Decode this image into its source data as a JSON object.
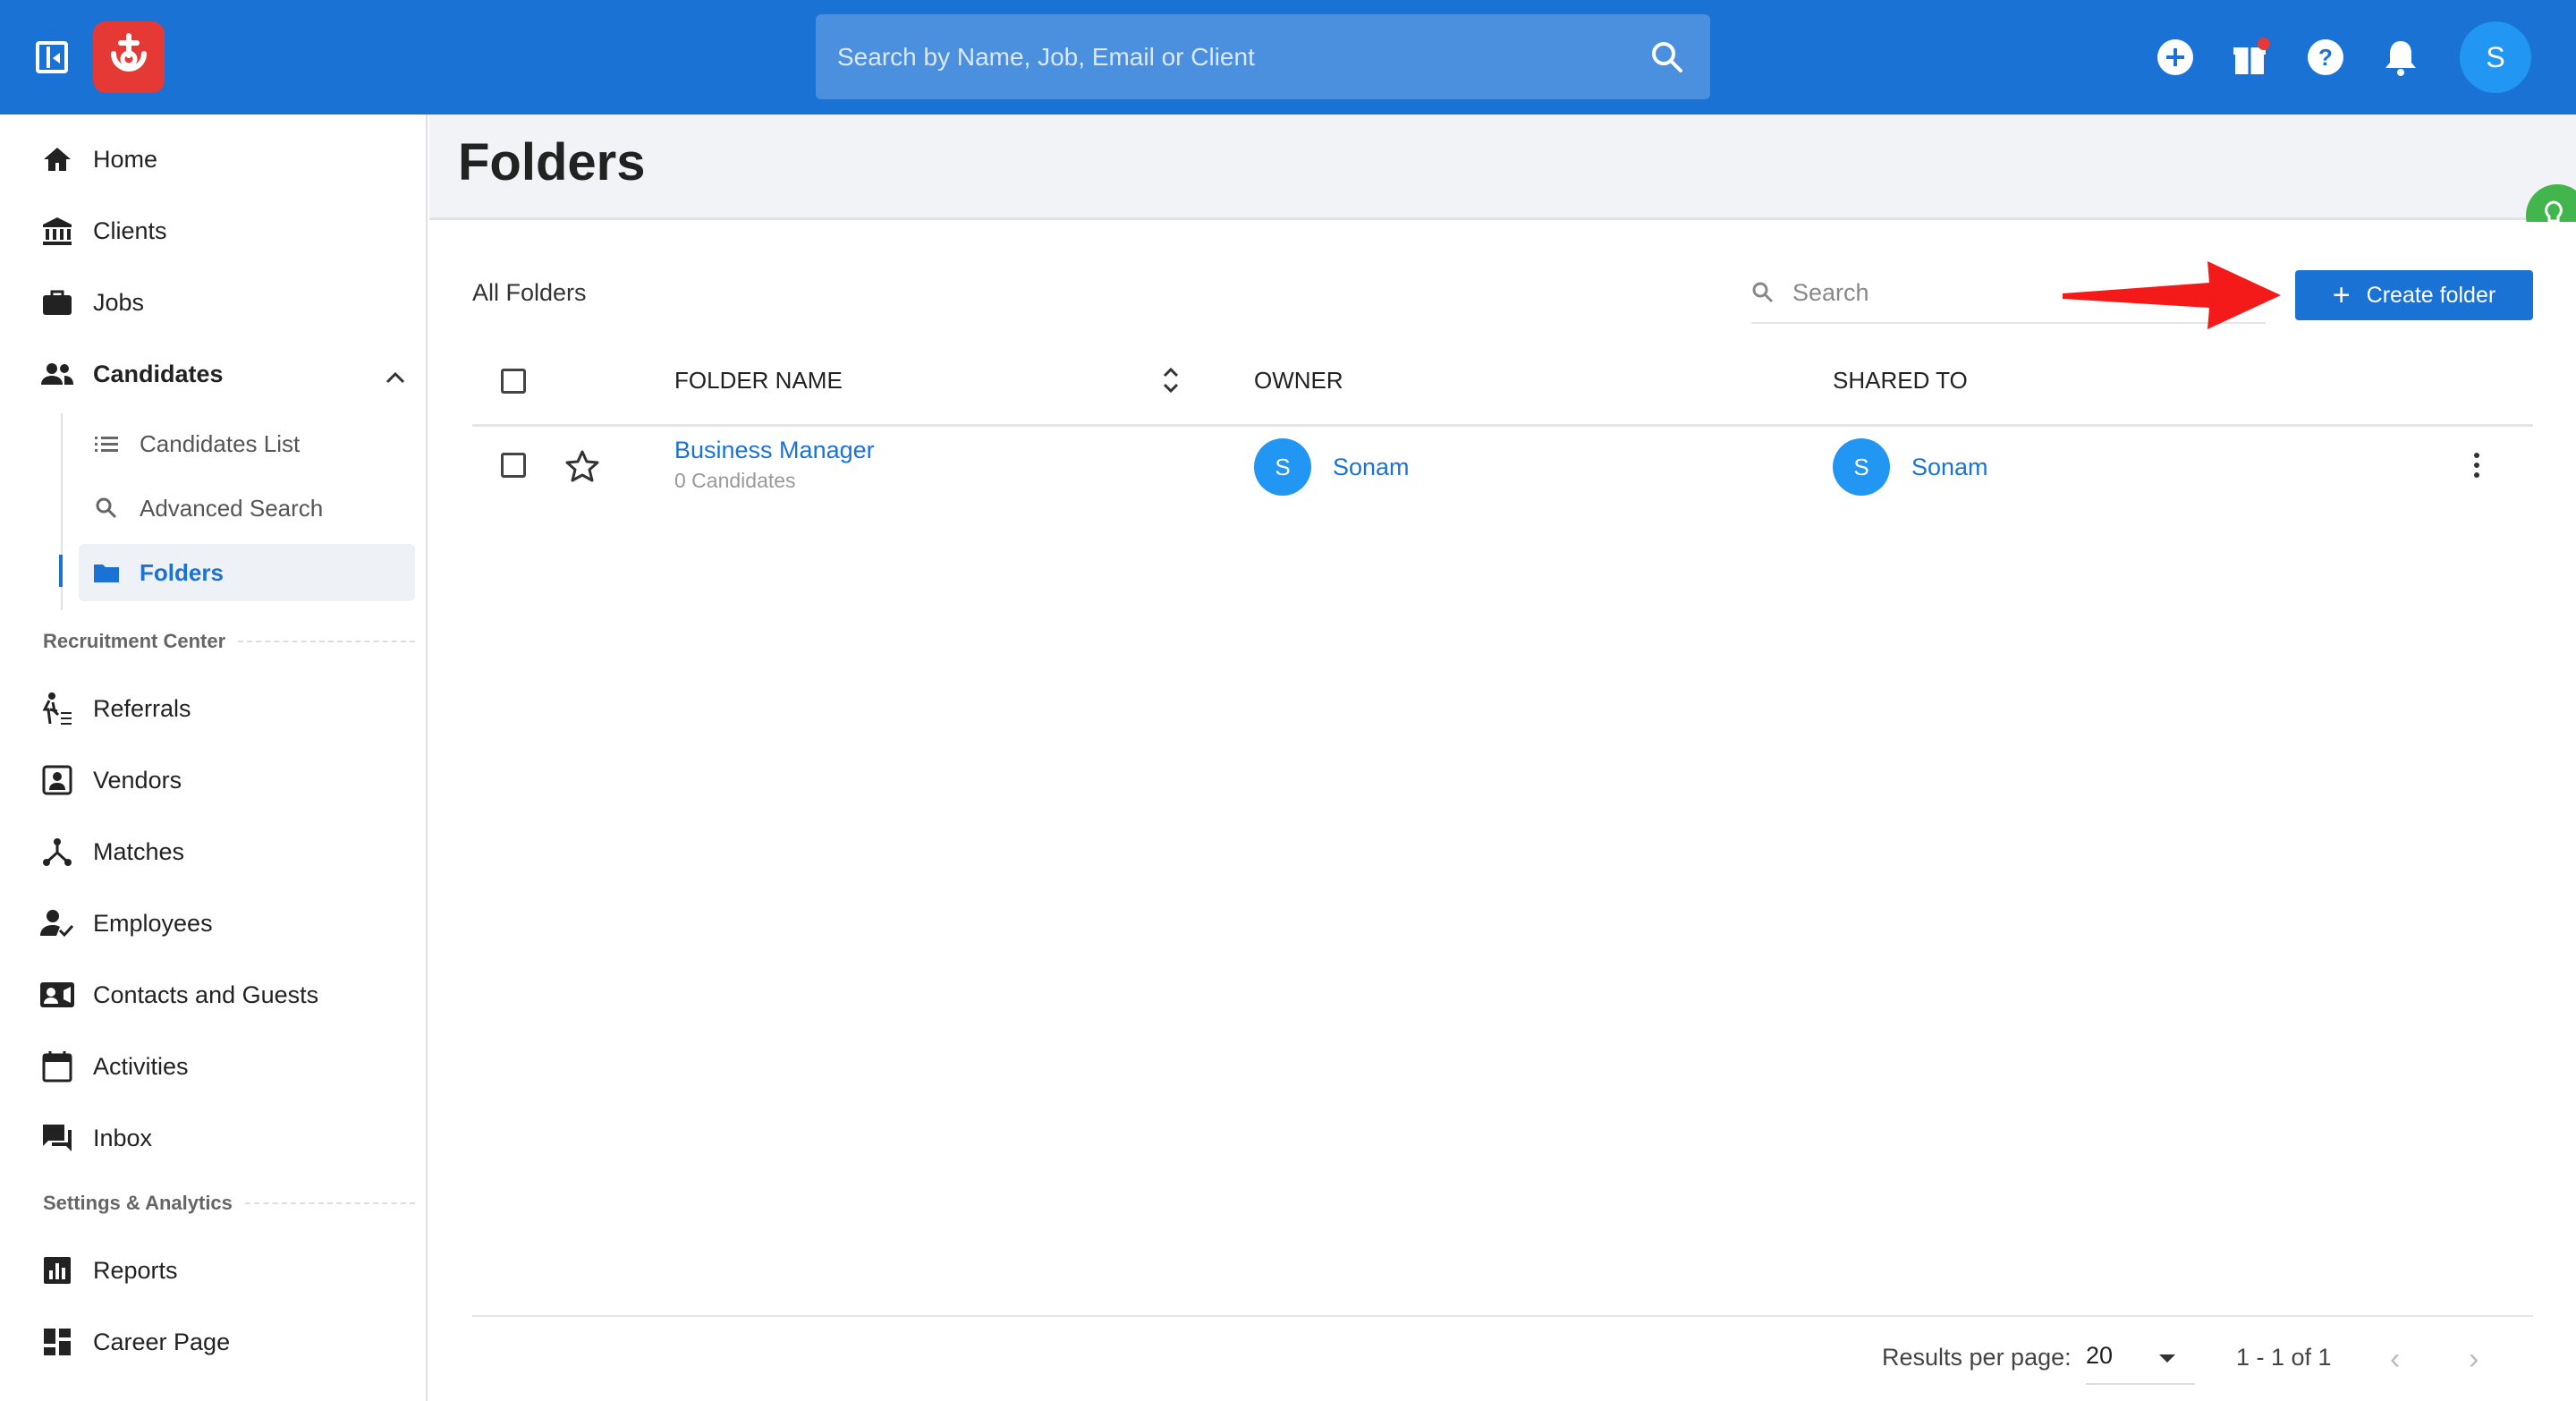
{
  "topbar": {
    "search_placeholder": "Search by Name, Job, Email or Client",
    "avatar_initial": "S",
    "brand_color": "#1a73d4"
  },
  "sidebar": {
    "items": [
      {
        "label": "Home",
        "icon": "home-icon"
      },
      {
        "label": "Clients",
        "icon": "bank-icon"
      },
      {
        "label": "Jobs",
        "icon": "briefcase-icon"
      },
      {
        "label": "Candidates",
        "icon": "people-icon"
      }
    ],
    "candidates_sub": [
      {
        "label": "Candidates List",
        "icon": "list-icon"
      },
      {
        "label": "Advanced Search",
        "icon": "search-icon"
      },
      {
        "label": "Folders",
        "icon": "folder-icon",
        "active": true
      }
    ],
    "section_recruitment": "Recruitment Center",
    "recruitment_items": [
      {
        "label": "Referrals",
        "icon": "referral-icon"
      },
      {
        "label": "Vendors",
        "icon": "vendor-icon"
      },
      {
        "label": "Matches",
        "icon": "matches-icon"
      },
      {
        "label": "Employees",
        "icon": "employee-icon"
      },
      {
        "label": "Contacts and Guests",
        "icon": "contacts-icon"
      },
      {
        "label": "Activities",
        "icon": "calendar-icon"
      },
      {
        "label": "Inbox",
        "icon": "inbox-icon"
      }
    ],
    "section_settings": "Settings & Analytics",
    "settings_items": [
      {
        "label": "Reports",
        "icon": "reports-icon"
      },
      {
        "label": "Career Page",
        "icon": "dashboard-icon"
      }
    ]
  },
  "page": {
    "title": "Folders",
    "subtitle": "All Folders",
    "search_placeholder": "Search",
    "create_label": "Create folder"
  },
  "table": {
    "headers": [
      "FOLDER NAME",
      "OWNER",
      "SHARED TO"
    ],
    "rows": [
      {
        "name": "Business Manager",
        "count": "0 Candidates",
        "owner": "Sonam",
        "owner_initial": "S",
        "shared": "Sonam",
        "shared_initial": "S"
      }
    ]
  },
  "footer": {
    "results_label": "Results per page:",
    "per_page": "20",
    "range": "1 - 1 of 1"
  }
}
